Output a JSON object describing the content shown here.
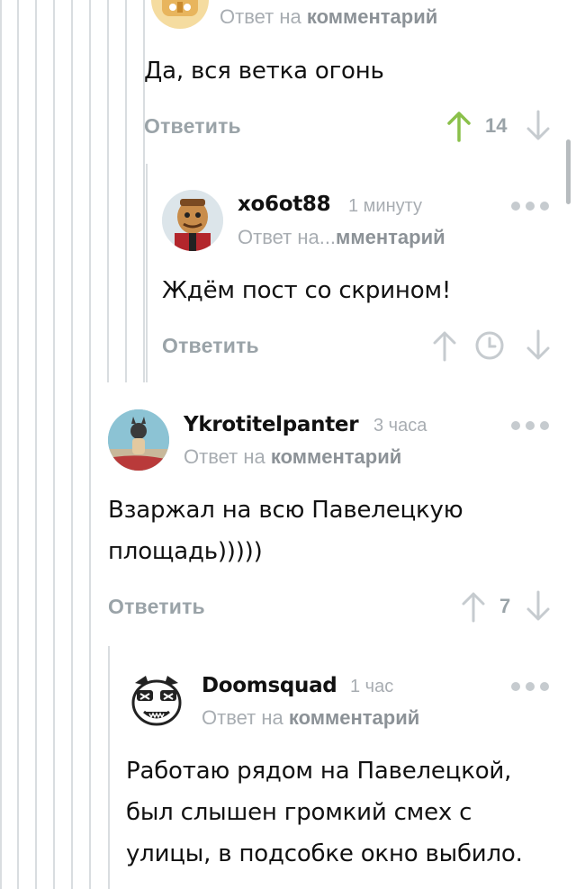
{
  "comments": [
    {
      "text": "Да, вся ветка огонь",
      "reply_prefix": "Ответ на",
      "reply_target": "комментарий",
      "reply_label": "Ответить",
      "rating": "14",
      "vote_state": "up",
      "accent": "#8ac04a"
    },
    {
      "username": "xo6ot88",
      "time": "1 минуту",
      "reply_prefix": "Ответ на...",
      "reply_target": "мментарий",
      "text": "Ждём пост со скрином!",
      "reply_label": "Ответить",
      "rating_icon": "clock-icon"
    },
    {
      "username": "Ykrotitelpanter",
      "time": "3 часа",
      "reply_prefix": "Ответ на",
      "reply_target": "комментарий",
      "text_lines": [
        "Взаржал на всю Павелецкую",
        "площадь)))))"
      ],
      "reply_label": "Ответить",
      "rating": "7"
    },
    {
      "username": "Doomsquad",
      "time": "1 час",
      "reply_prefix": "Ответ на",
      "reply_target": "комментарий",
      "text_lines": [
        "Работаю рядом на Павелецкой,",
        "был слышен громкий смех с",
        "улицы, в подсобке окно выбило."
      ]
    }
  ],
  "colors": {
    "thread_line": "#d9dde0",
    "muted": "#a8adb2",
    "upvoted": "#8ac04a"
  }
}
